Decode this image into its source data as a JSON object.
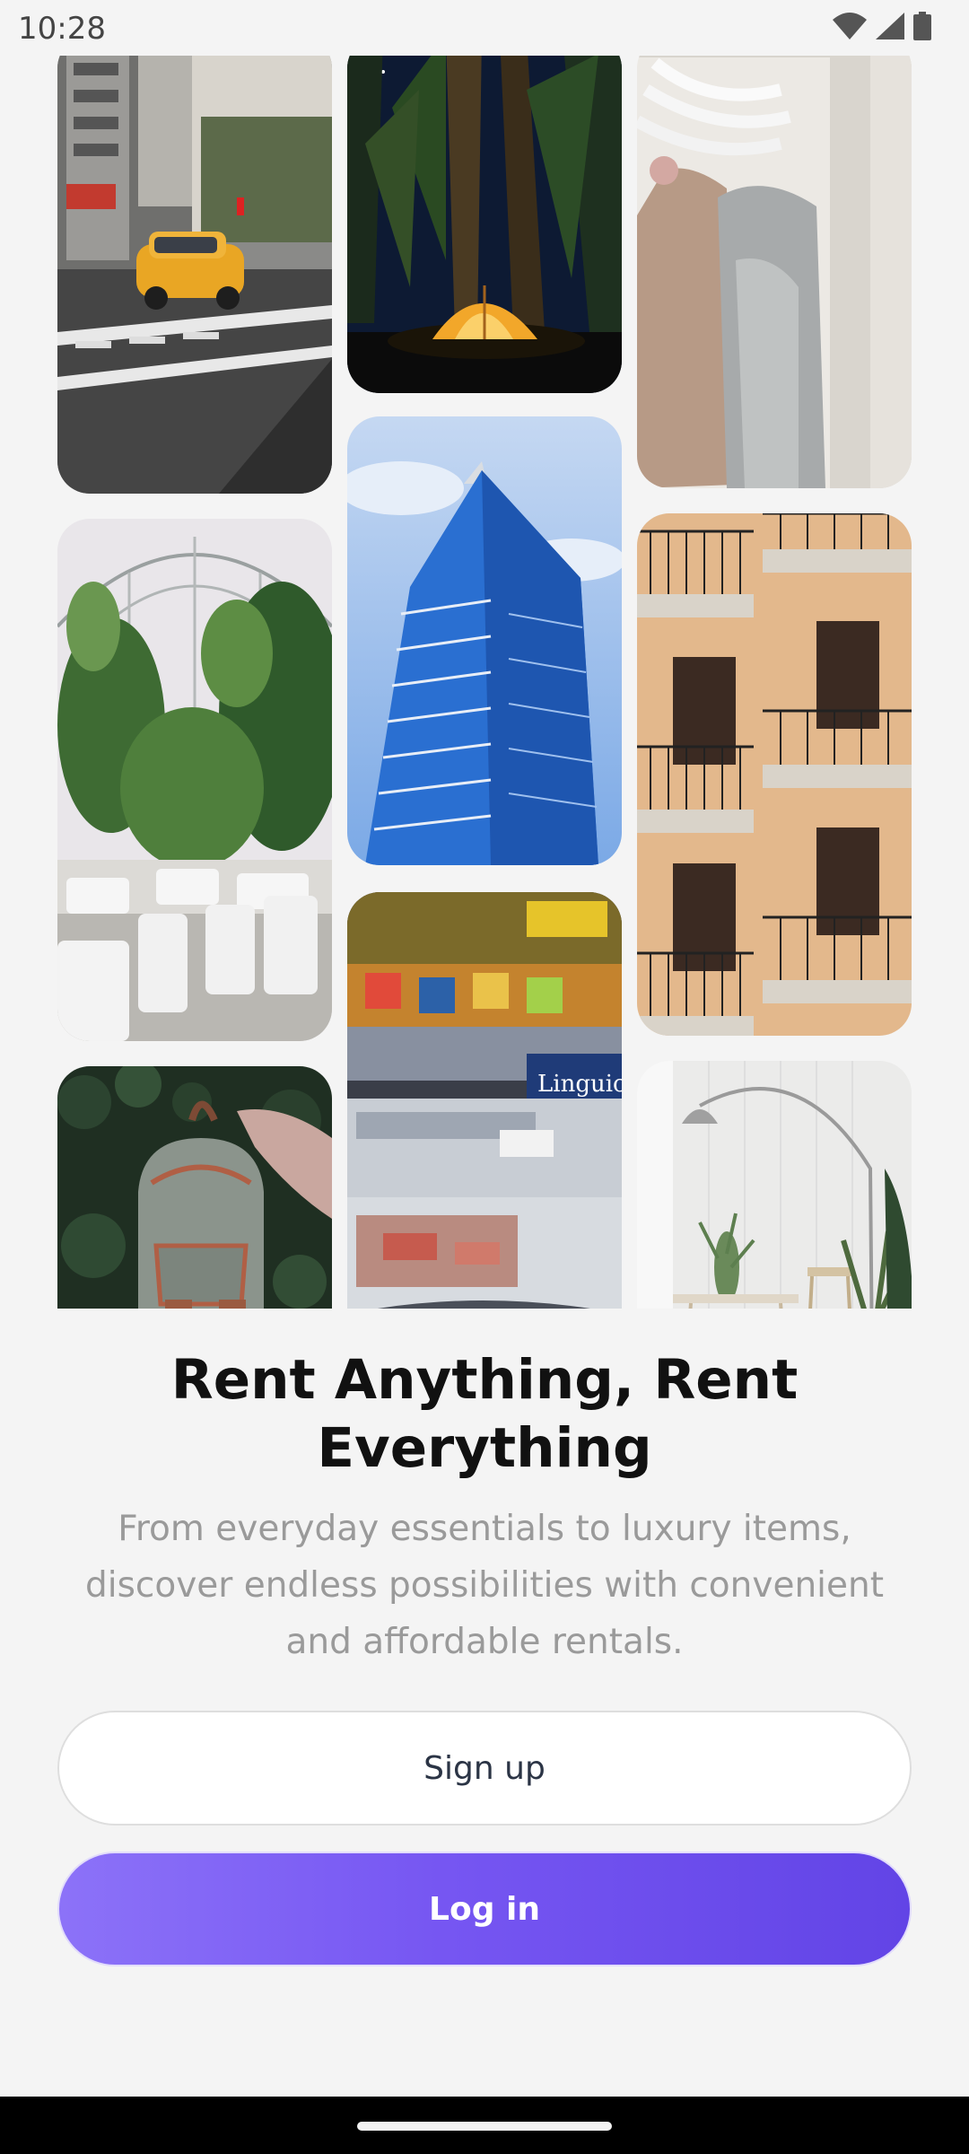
{
  "status_bar": {
    "time": "10:28",
    "icons": [
      "wifi-icon",
      "cellular-signal-icon",
      "battery-icon"
    ]
  },
  "gallery": {
    "images": [
      "taxi-street-photo",
      "camping-tent-forest-photo",
      "clothing-rack-photo",
      "greenhouse-venue-photo",
      "glass-skyscraper-photo",
      "apartment-balconies-photo",
      "backpack-photo",
      "supermarket-freezer-photo",
      "white-interior-lamp-photo"
    ],
    "freezer_sign": "Linguic"
  },
  "hero": {
    "title": "Rent Anything, Rent Everything",
    "subtitle": "From everyday essentials to luxury items, discover endless possibilities with convenient and affordable rentals."
  },
  "actions": {
    "signup_label": "Sign up",
    "login_label": "Log in"
  },
  "colors": {
    "background": "#f4f4f4",
    "accent_start": "#8c72f8",
    "accent_end": "#6244e6",
    "title": "#111111",
    "subtitle": "#9a9a9a"
  }
}
